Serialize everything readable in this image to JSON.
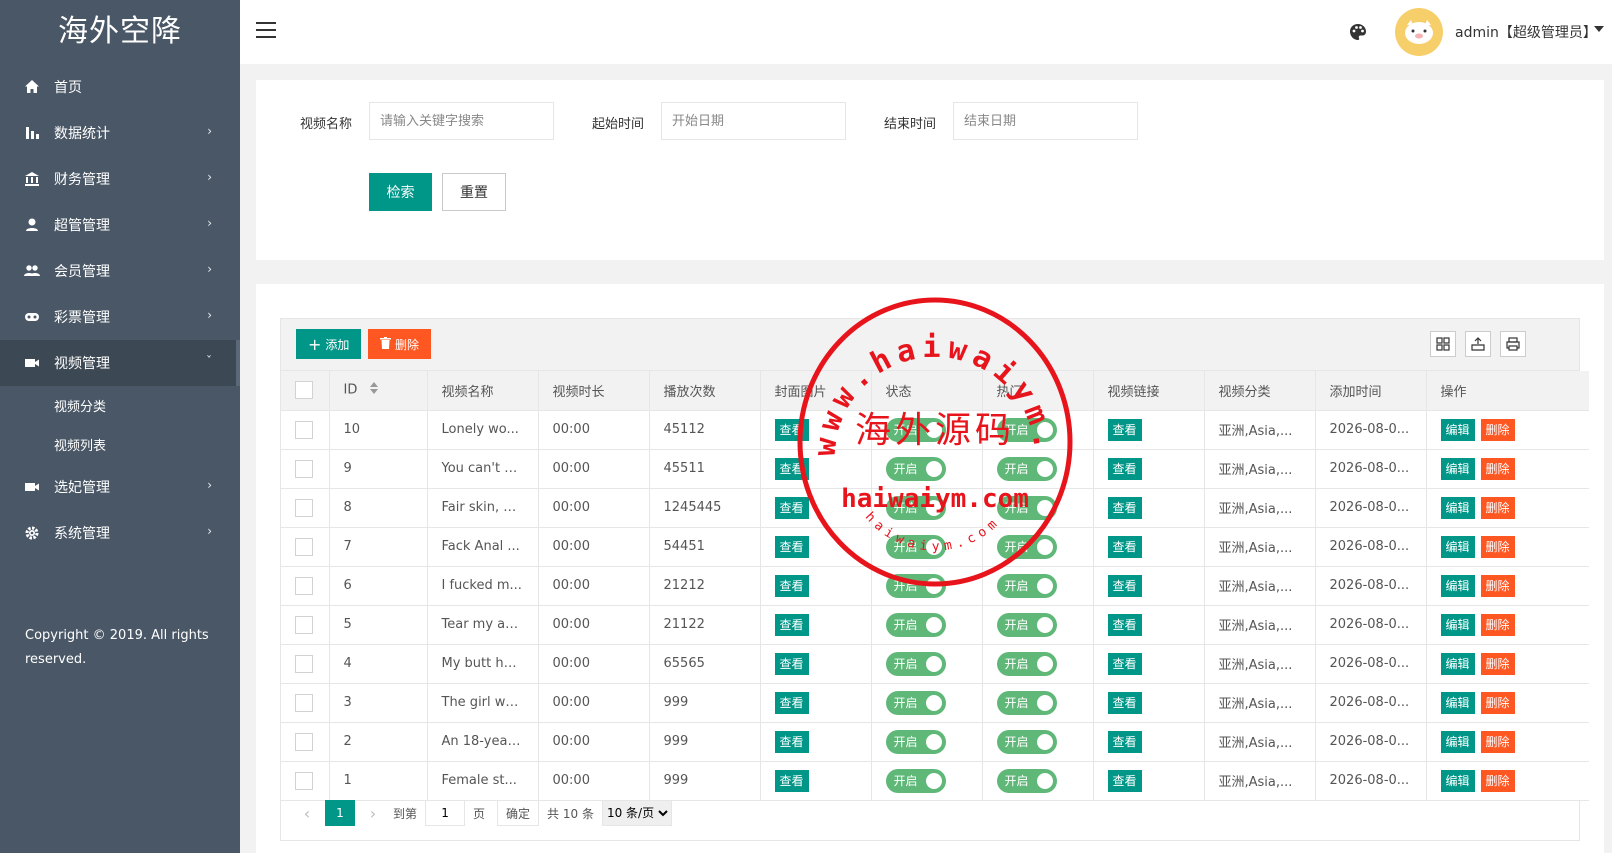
{
  "sidebar": {
    "logo": "海外空降",
    "items": [
      {
        "label": "首页",
        "icon": "home-icon",
        "has_arrow": false
      },
      {
        "label": "数据统计",
        "icon": "chart-bar-icon",
        "has_arrow": true
      },
      {
        "label": "财务管理",
        "icon": "bank-icon",
        "has_arrow": true
      },
      {
        "label": "超管管理",
        "icon": "user-icon",
        "has_arrow": true
      },
      {
        "label": "会员管理",
        "icon": "users-icon",
        "has_arrow": true
      },
      {
        "label": "彩票管理",
        "icon": "gamepad-icon",
        "has_arrow": true
      },
      {
        "label": "视频管理",
        "icon": "video-icon",
        "has_arrow": true,
        "expanded": true
      },
      {
        "label": "选妃管理",
        "icon": "video-icon",
        "has_arrow": true
      },
      {
        "label": "系统管理",
        "icon": "gear-icon",
        "has_arrow": true
      }
    ],
    "sub_items": [
      "视频分类",
      "视频列表"
    ],
    "copyright": "Copyright © 2019. All rights reserved."
  },
  "header": {
    "user": "admin【超级管理员】"
  },
  "search": {
    "name_label": "视频名称",
    "name_placeholder": "请输入关键字搜索",
    "start_label": "起始时间",
    "start_placeholder": "开始日期",
    "end_label": "结束时间",
    "end_placeholder": "结束日期",
    "search_button": "检索",
    "reset_button": "重置"
  },
  "toolbar": {
    "add_label": "添加",
    "delete_label": "删除"
  },
  "table": {
    "columns": [
      "ID",
      "视频名称",
      "视频时长",
      "播放次数",
      "封面图片",
      "状态",
      "热门",
      "视频链接",
      "视频分类",
      "添加时间",
      "操作"
    ],
    "view_label": "查看",
    "switch_label": "开启",
    "edit_label": "编辑",
    "remove_label": "删除",
    "rows": [
      {
        "id": "10",
        "name": "Lonely wo...",
        "duration": "00:00",
        "plays": "45112",
        "category": "亚洲,Asia,...",
        "added": "2026-08-0..."
      },
      {
        "id": "9",
        "name": "You can't c...",
        "duration": "00:00",
        "plays": "45511",
        "category": "亚洲,Asia,...",
        "added": "2026-08-0..."
      },
      {
        "id": "8",
        "name": "Fair skin, b...",
        "duration": "00:00",
        "plays": "1245445",
        "category": "亚洲,Asia,...",
        "added": "2026-08-0..."
      },
      {
        "id": "7",
        "name": "Fack Anal ...",
        "duration": "00:00",
        "plays": "54451",
        "category": "亚洲,Asia,...",
        "added": "2026-08-0..."
      },
      {
        "id": "6",
        "name": "I fucked m...",
        "duration": "00:00",
        "plays": "21212",
        "category": "亚洲,Asia,...",
        "added": "2026-08-0..."
      },
      {
        "id": "5",
        "name": "Tear my as...",
        "duration": "00:00",
        "plays": "21122",
        "category": "亚洲,Asia,...",
        "added": "2026-08-0..."
      },
      {
        "id": "4",
        "name": "My butt hu...",
        "duration": "00:00",
        "plays": "65565",
        "category": "亚洲,Asia,...",
        "added": "2026-08-0..."
      },
      {
        "id": "3",
        "name": "The girl wa...",
        "duration": "00:00",
        "plays": "999",
        "category": "亚洲,Asia,...",
        "added": "2026-08-0..."
      },
      {
        "id": "2",
        "name": "An 18-year...",
        "duration": "00:00",
        "plays": "999",
        "category": "亚洲,Asia,...",
        "added": "2026-08-0..."
      },
      {
        "id": "1",
        "name": "Female st...",
        "duration": "00:00",
        "plays": "999",
        "category": "亚洲,Asia,...",
        "added": "2026-08-0..."
      }
    ]
  },
  "pager": {
    "current_page": "1",
    "goto_label": "到第",
    "goto_value": "1",
    "page_unit": "页",
    "confirm_label": "确定",
    "total_label": "共 10 条",
    "page_size": "10 条/页"
  },
  "watermark": {
    "top_arc": "www.haiwaiym.com",
    "center": "海外源码",
    "middle": "haiwaiym.com",
    "bottom_arc": "haiwaiym.com"
  },
  "colors": {
    "sidebar_bg": "#4a5766",
    "primary": "#009688",
    "danger": "#ff5722",
    "switch_on": "#5fb878",
    "stamp_red": "#e8141c"
  }
}
